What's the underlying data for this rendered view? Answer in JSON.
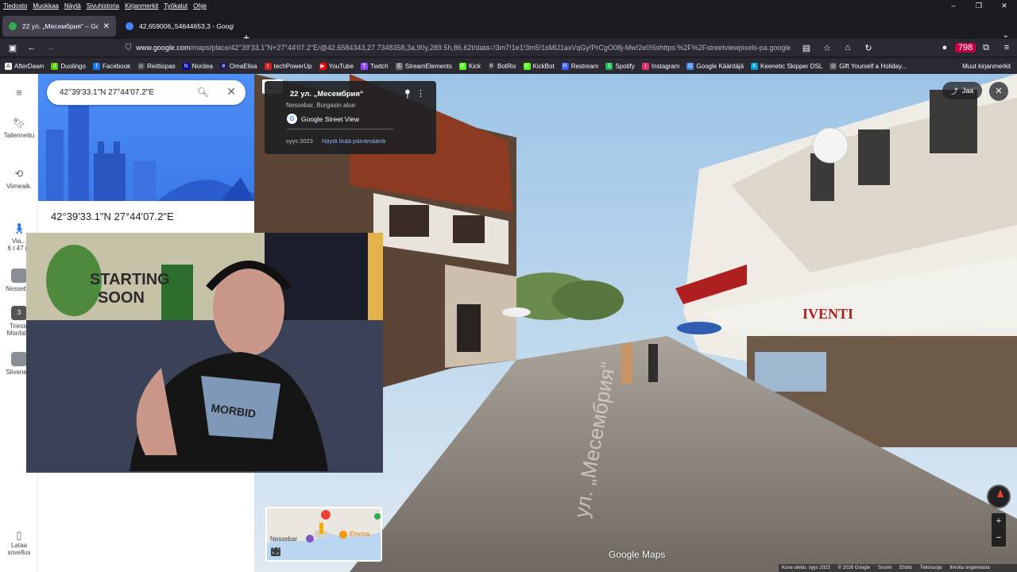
{
  "menubar": {
    "items": [
      "Tiedosto",
      "Muokkaa",
      "Näytä",
      "Sivuhistoria",
      "Kirjanmerkit",
      "Työkalut",
      "Ohje"
    ]
  },
  "window_controls": {
    "minimize": "–",
    "restore": "❐",
    "close": "✕"
  },
  "tabs": [
    {
      "title": "22 ул. „Месембрия“ – Google M",
      "active": true,
      "favicon_color": "#34a853"
    },
    {
      "title": "42,659006,,54644653,3 - Google",
      "active": false,
      "favicon_color": "#4285f4"
    }
  ],
  "navbar": {
    "url_domain": "www.google.com",
    "url_rest": "/maps/place/42°39'33.1\"N+27°44'07.2\"E/@42.6584343,27.7348358,3a,90y,289.5h,86.62t/data=!3m7!1e1!3m5!1sMlJ1axVqGy!PrCgO08j-Mw!2e0!6shttps:%2F%2Fstreetviewpixels-pa.google",
    "badge_count": "798"
  },
  "bookmarks": [
    {
      "label": "AfterDawn",
      "color": "#ffffff",
      "glyph": "A"
    },
    {
      "label": "Duolingo",
      "color": "#58cc02",
      "glyph": "d"
    },
    {
      "label": "Facebook",
      "color": "#1877f2",
      "glyph": "f"
    },
    {
      "label": "Reittiopas",
      "color": "#444444",
      "glyph": "◎"
    },
    {
      "label": "Nordea",
      "color": "#0000a0",
      "glyph": "N"
    },
    {
      "label": "OmaElisa",
      "color": "#1d1d6b",
      "glyph": "e"
    },
    {
      "label": "techPowerUp",
      "color": "#d31f1f",
      "glyph": "t"
    },
    {
      "label": "YouTube",
      "color": "#ff0000",
      "glyph": "▶"
    },
    {
      "label": "Twitch",
      "color": "#9146ff",
      "glyph": "T"
    },
    {
      "label": "StreamElements",
      "color": "#6e6e6e",
      "glyph": "S"
    },
    {
      "label": "Kick",
      "color": "#53fc18",
      "glyph": "K"
    },
    {
      "label": "BotRix",
      "color": "#333333",
      "glyph": "B"
    },
    {
      "label": "KickBot",
      "color": "#53fc18",
      "glyph": "K"
    },
    {
      "label": "Restream",
      "color": "#3a5bff",
      "glyph": "R"
    },
    {
      "label": "Spotify",
      "color": "#1db954",
      "glyph": "S"
    },
    {
      "label": "Instagram",
      "color": "#e1306c",
      "glyph": "I"
    },
    {
      "label": "Google Kääntäjä",
      "color": "#4285f4",
      "glyph": "G"
    },
    {
      "label": "Keenetic Skipper DSL",
      "color": "#00a0d6",
      "glyph": "K"
    },
    {
      "label": "Gift Yourself a Holiday...",
      "color": "#555555",
      "glyph": "◎"
    }
  ],
  "other_bookmarks": "Muut kirjanmerkit",
  "rail": {
    "menu": "≡",
    "saved": "Tallennettu",
    "recent": "Viimeaik.",
    "trip_label": "Via...",
    "trip_time": "6 t 47 m",
    "recent1": "Nesseb...",
    "recent2": "Trieste Monfal...",
    "recent3": "Slivene...",
    "recent2_count": "3",
    "download_app": "Lataa sovellus"
  },
  "search": {
    "query": "42°39'33.1\"N 27°44'07.2\"E"
  },
  "place_title": "42°39'33.1\"N 27°44'07.2\"E",
  "streetview": {
    "title": "22 ул. „Месембрия“",
    "subtitle": "Nessebar, Burgasin alue",
    "provider": "Google Street View",
    "capture_date": "syys 2023",
    "more_dates": "Näytä lisää päivämääriä",
    "share_label": "Jaa",
    "shop_sign": "IVENTI",
    "street_label": "ул. „Месембрия“",
    "watermark": "Google Maps"
  },
  "minimap": {
    "label_town": "Nessebar",
    "label_place": "Emona"
  },
  "footer": {
    "items": [
      "Kuva otettu: syys 2023",
      "© 2026 Google",
      "Suomi",
      "Ehdot",
      "Tietosuoja",
      "Ilmoita ongelmasta"
    ]
  },
  "webcam": {
    "poster_text_1": "STARTING",
    "poster_text_2": "SOON",
    "shirt_text": "MORBID"
  }
}
